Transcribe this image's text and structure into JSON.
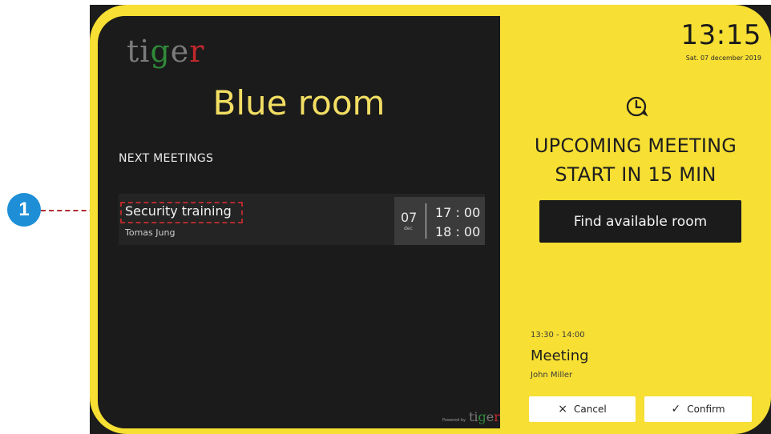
{
  "callout": {
    "number": "1"
  },
  "device": {
    "logo": {
      "part1": "ti",
      "part2": "g",
      "part3": "e",
      "part4": "r"
    },
    "room_name": "Blue room",
    "next_meetings": {
      "heading": "NEXT MEETINGS",
      "items": [
        {
          "title": "Security training",
          "organizer": "Tomas Jung",
          "day": "07",
          "month": "dec",
          "start": "17 : 00",
          "end": "18 : 00"
        }
      ]
    },
    "powered_by": {
      "label": "Powered by",
      "logo": {
        "part1": "ti",
        "part2": "g",
        "part3": "e",
        "part4": "r"
      }
    }
  },
  "sidebar": {
    "clock": "13:15",
    "date": "Sat. 07 december 2019",
    "upcoming_line1": "UPCOMING MEETING",
    "upcoming_line2": "START IN 15 MIN",
    "find_room_label": "Find available room",
    "next_meeting": {
      "time": "13:30 - 14:00",
      "title": "Meeting",
      "organizer": "John Miller"
    },
    "cancel_label": "Cancel",
    "confirm_label": "Confirm"
  },
  "colors": {
    "yellow": "#f7df33",
    "dark": "#1b1b1b",
    "title_yellow": "#f2de63",
    "callout_blue": "#1e8fd6",
    "callout_red": "#b32a2a"
  },
  "icons": {
    "timer": "timer-icon",
    "cancel": "close-icon",
    "confirm": "check-icon"
  }
}
